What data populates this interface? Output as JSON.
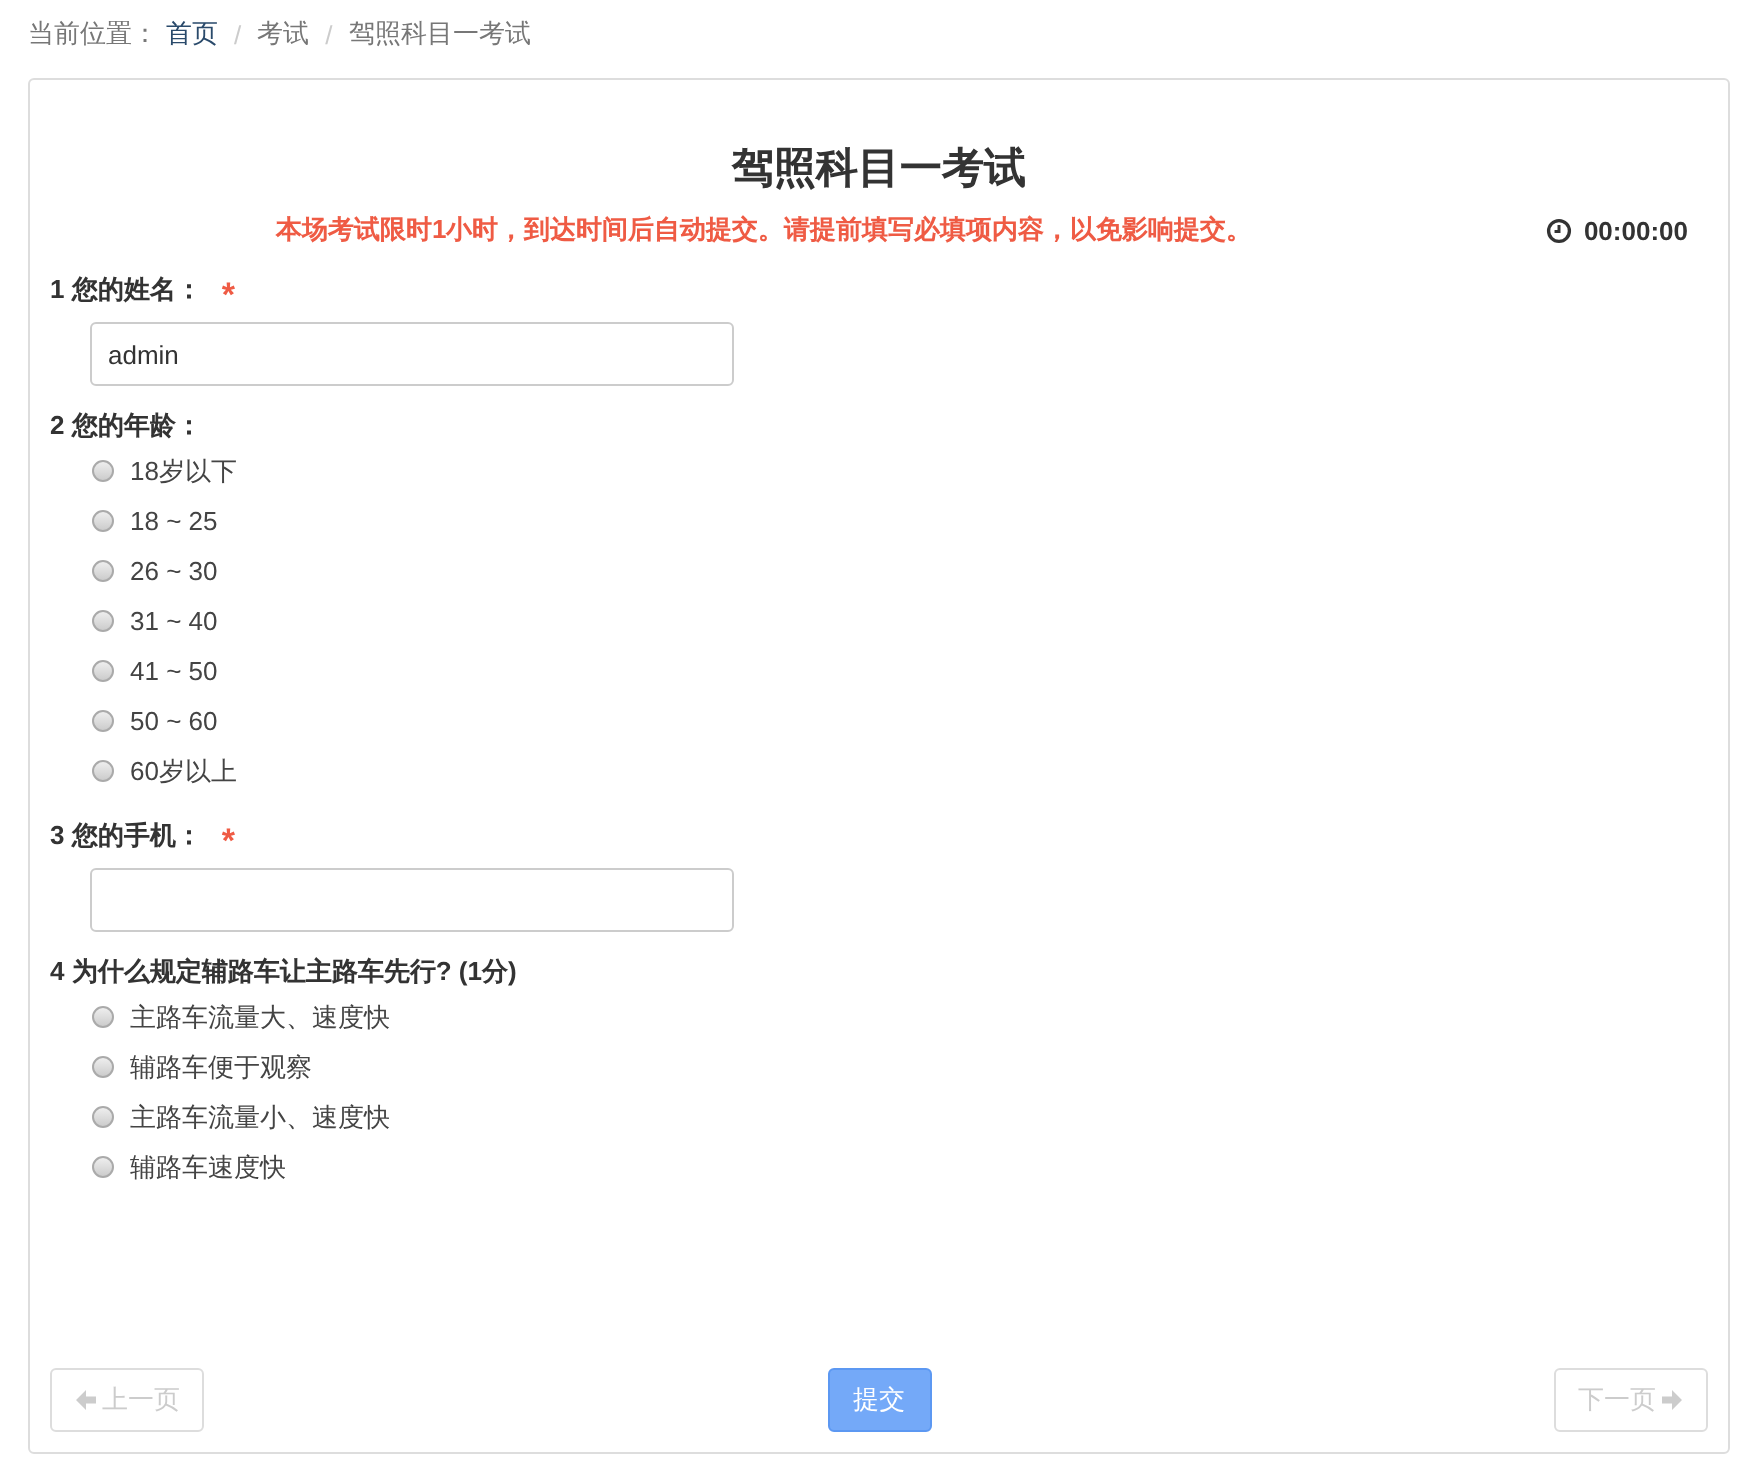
{
  "breadcrumb": {
    "label": "当前位置：",
    "items": [
      {
        "text": "首页",
        "kind": "link"
      },
      {
        "text": "考试",
        "kind": "plain"
      },
      {
        "text": "驾照科目一考试",
        "kind": "plain"
      }
    ],
    "separator": "/"
  },
  "exam": {
    "title": "驾照科目一考试",
    "notice": "本场考试限时1小时，到达时间后自动提交。请提前填写必填项内容，以免影响提交。",
    "timer": "00:00:00"
  },
  "questions": [
    {
      "label": "1 您的姓名：",
      "kind": "text",
      "required": true,
      "value": "admin"
    },
    {
      "label": "2 您的年龄：",
      "kind": "radio",
      "required": false,
      "options": [
        {
          "text": "18岁以下",
          "selected": false
        },
        {
          "text": "18 ~ 25",
          "selected": false
        },
        {
          "text": "26 ~ 30",
          "selected": false
        },
        {
          "text": "31 ~ 40",
          "selected": false
        },
        {
          "text": "41 ~ 50",
          "selected": false
        },
        {
          "text": "50 ~ 60",
          "selected": false
        },
        {
          "text": "60岁以上",
          "selected": false
        }
      ]
    },
    {
      "label": "3 您的手机：",
      "kind": "text",
      "required": true
    },
    {
      "label": "4 为什么规定辅路车让主路车先行? (1分)",
      "kind": "radio",
      "required": false,
      "options": [
        {
          "text": "主路车流量大、速度快",
          "selected": false
        },
        {
          "text": "辅路车便于观察",
          "selected": false
        },
        {
          "text": "主路车流量小、速度快",
          "selected": false
        },
        {
          "text": "辅路车速度快",
          "selected": false
        }
      ]
    }
  ],
  "buttons": {
    "prev": {
      "text": "上一页",
      "disabled": true
    },
    "submit": {
      "text": "提交",
      "disabled": false
    },
    "next": {
      "text": "下一页",
      "disabled": true
    }
  },
  "required_mark": "*"
}
